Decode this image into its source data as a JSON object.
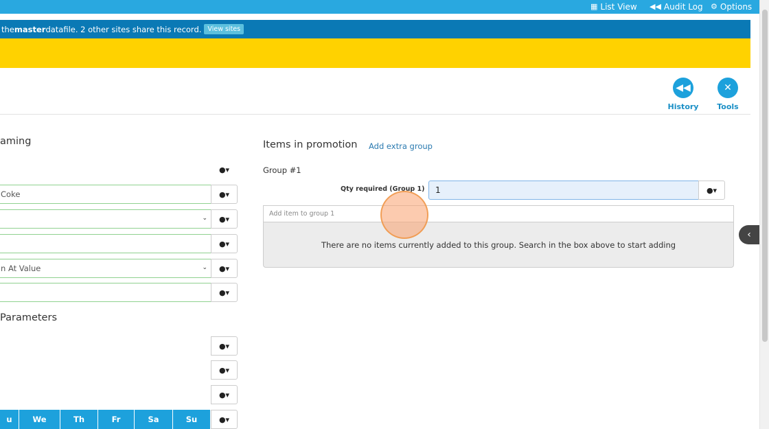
{
  "topnav": {
    "list_view": "List View",
    "audit_log": "Audit Log",
    "options": "Options"
  },
  "info": {
    "prefix": "the ",
    "bold": "master",
    "suffix": " datafile. 2 other sites share this record.",
    "button": "View sites"
  },
  "toolbar": {
    "history": "History",
    "tools": "Tools"
  },
  "left": {
    "section1_title": "aming",
    "fields": [
      {
        "value": "Coke"
      },
      {
        "value": ""
      },
      {
        "value": ""
      },
      {
        "value": "n At Value"
      },
      {
        "value": ""
      }
    ],
    "section2_title": "Parameters",
    "days": [
      "u",
      "We",
      "Th",
      "Fr",
      "Sa",
      "Su"
    ]
  },
  "right": {
    "title": "Items in promotion",
    "add_group": "Add extra group",
    "group_label": "Group #1",
    "qty_label": "Qty required (Group 1)",
    "qty_value": "1",
    "add_item_placeholder": "Add item to group 1",
    "empty_message": "There are no items currently added to this group. Search in the box above to start adding"
  },
  "colors": {
    "topbar": "#29a8e0",
    "infobar": "#0a79b5",
    "warning": "#ffd200",
    "accent": "#1da1dc"
  }
}
